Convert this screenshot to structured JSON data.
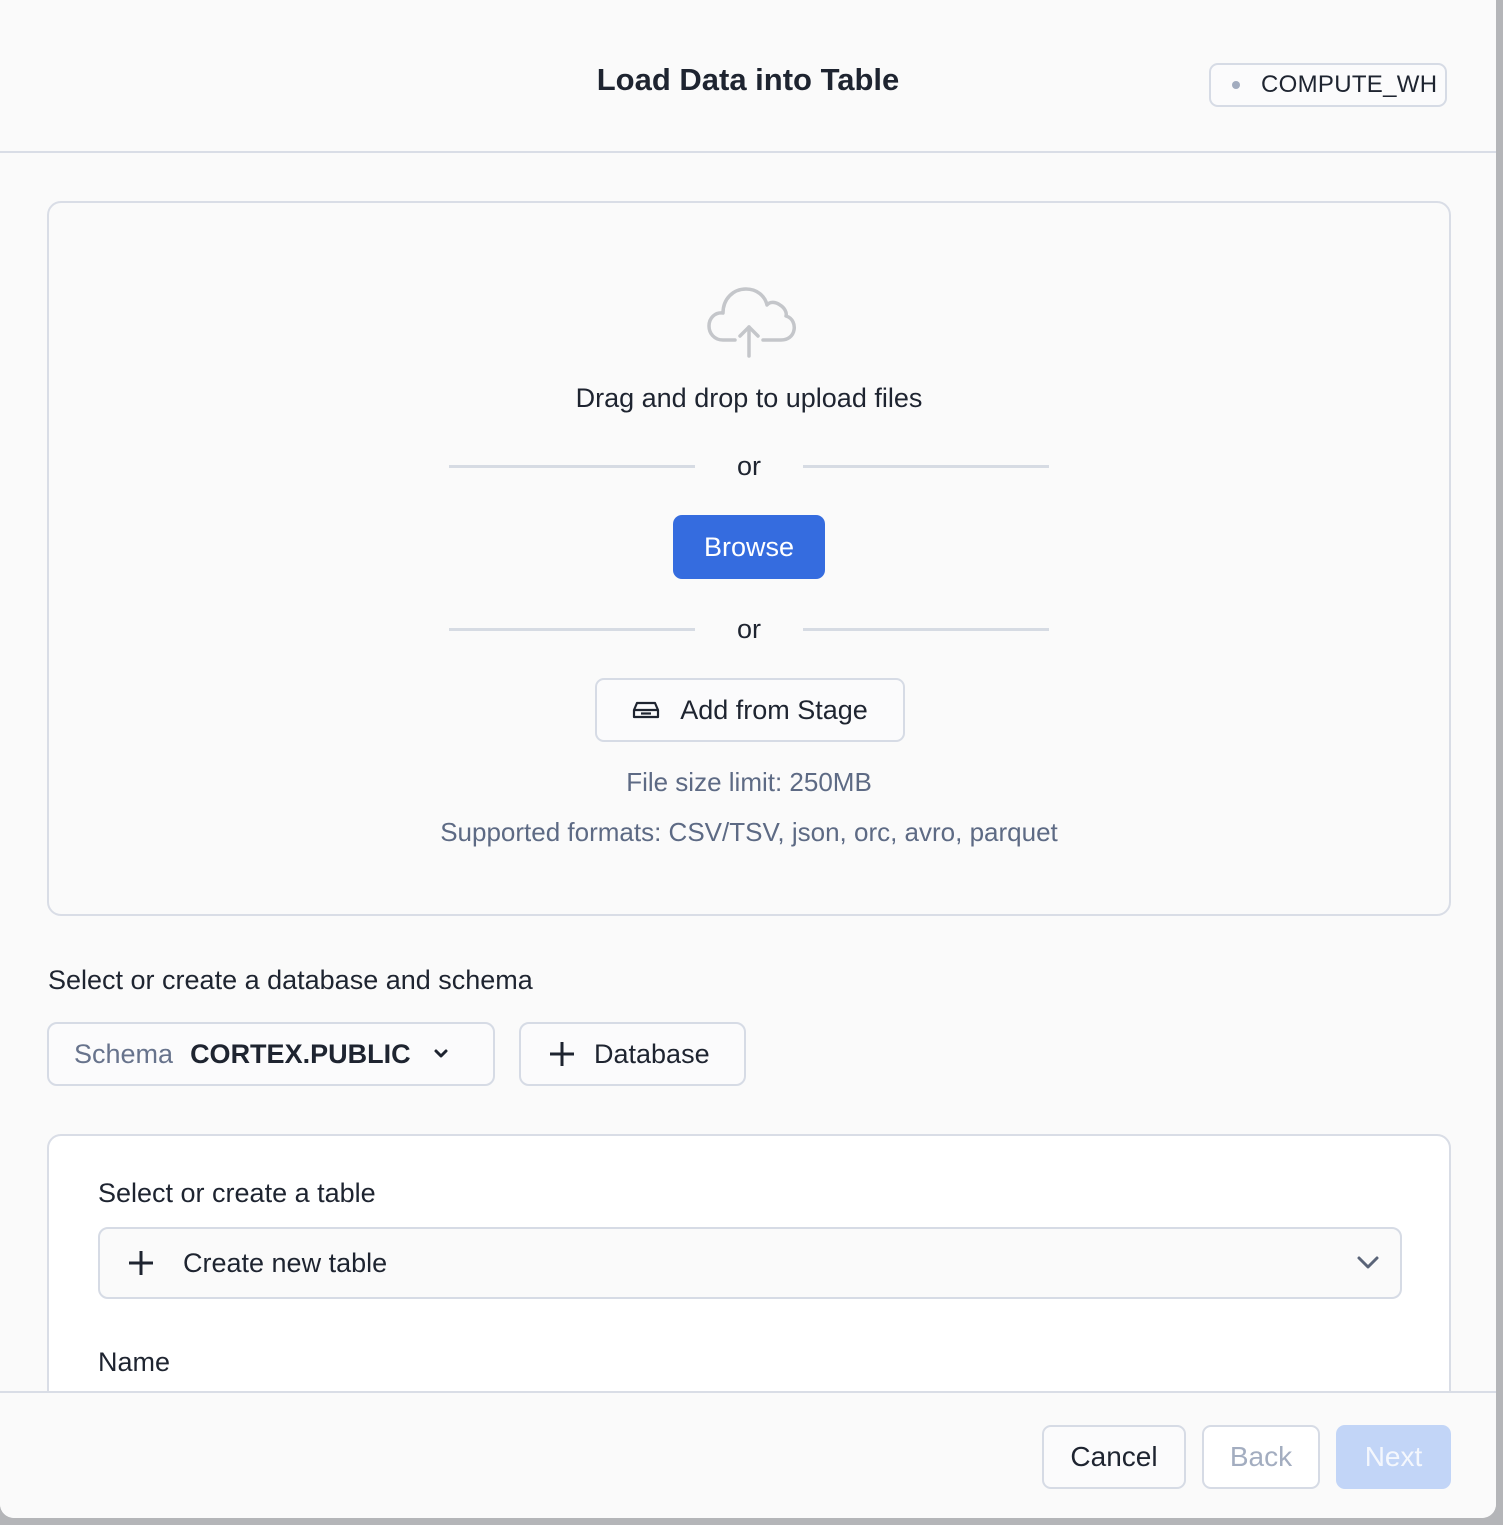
{
  "header": {
    "title": "Load Data into Table",
    "warehouse": {
      "label": "COMPUTE_WH",
      "status_icon": "status-dot-icon",
      "status_color": "#a2acbf"
    }
  },
  "upload": {
    "icon": "cloud-upload-icon",
    "drag_text": "Drag and drop to upload files",
    "or_1": "or",
    "browse_label": "Browse",
    "or_2": "or",
    "stage_icon": "stage-icon",
    "stage_label": "Add from Stage",
    "size_limit": "File size limit: 250MB",
    "formats": "Supported formats: CSV/TSV, json, orc, avro, parquet"
  },
  "schema_section": {
    "label": "Select or create a database and schema",
    "schema_key": "Schema",
    "schema_value": "CORTEX.PUBLIC",
    "database_button": "Database"
  },
  "table_section": {
    "label": "Select or create a table",
    "selected": "Create new table",
    "name_label": "Name"
  },
  "footer": {
    "cancel": "Cancel",
    "back": "Back",
    "next": "Next"
  },
  "colors": {
    "primary": "#356cdf",
    "primary_disabled": "#c2d5f7",
    "border": "#d6dbe5",
    "text": "#1e2430",
    "muted_text": "#5d6a84"
  }
}
